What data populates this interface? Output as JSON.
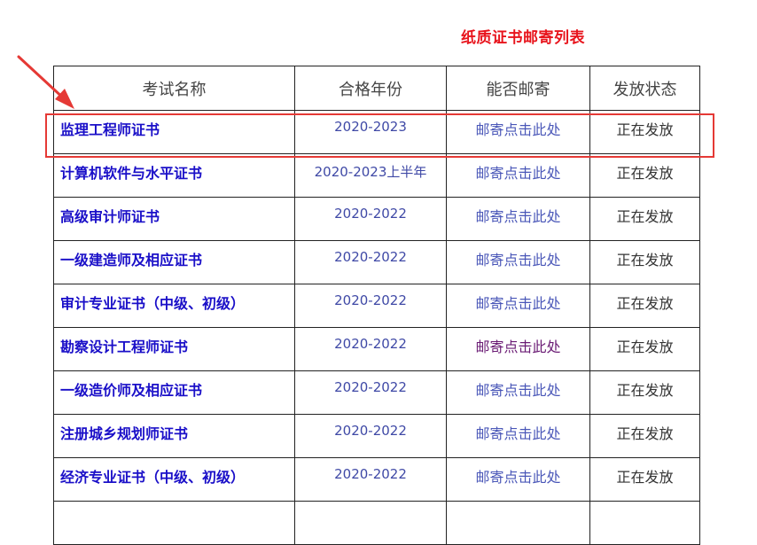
{
  "title": "纸质证书邮寄列表",
  "headers": {
    "name": "考试名称",
    "year": "合格年份",
    "mail": "能否邮寄",
    "status": "发放状态"
  },
  "rows": [
    {
      "name": "监理工程师证书",
      "year": "2020-2023",
      "mail": "邮寄点击此处",
      "status": "正在发放",
      "visited": false
    },
    {
      "name": "计算机软件与水平证书",
      "year": "2020-2023上半年",
      "mail": "邮寄点击此处",
      "status": "正在发放",
      "visited": false
    },
    {
      "name": "高级审计师证书",
      "year": "2020-2022",
      "mail": "邮寄点击此处",
      "status": "正在发放",
      "visited": false
    },
    {
      "name": "一级建造师及相应证书",
      "year": "2020-2022",
      "mail": "邮寄点击此处",
      "status": "正在发放",
      "visited": false
    },
    {
      "name": "审计专业证书（中级、初级）",
      "year": "2020-2022",
      "mail": "邮寄点击此处",
      "status": "正在发放",
      "visited": false
    },
    {
      "name": "勘察设计工程师证书",
      "year": "2020-2022",
      "mail": "邮寄点击此处",
      "status": "正在发放",
      "visited": true
    },
    {
      "name": "一级造价师及相应证书",
      "year": "2020-2022",
      "mail": "邮寄点击此处",
      "status": "正在发放",
      "visited": false
    },
    {
      "name": "注册城乡规划师证书",
      "year": "2020-2022",
      "mail": "邮寄点击此处",
      "status": "正在发放",
      "visited": false
    },
    {
      "name": "经济专业证书（中级、初级）",
      "year": "2020-2022",
      "mail": "邮寄点击此处",
      "status": "正在发放",
      "visited": false
    },
    {
      "name": "",
      "year": "",
      "mail": "",
      "status": "",
      "visited": false
    }
  ],
  "colors": {
    "title": "#e8141c",
    "name_text": "#1a0fc8",
    "link": "#4a57b8",
    "visited_link": "#6a1b74",
    "highlight": "#e53935"
  }
}
